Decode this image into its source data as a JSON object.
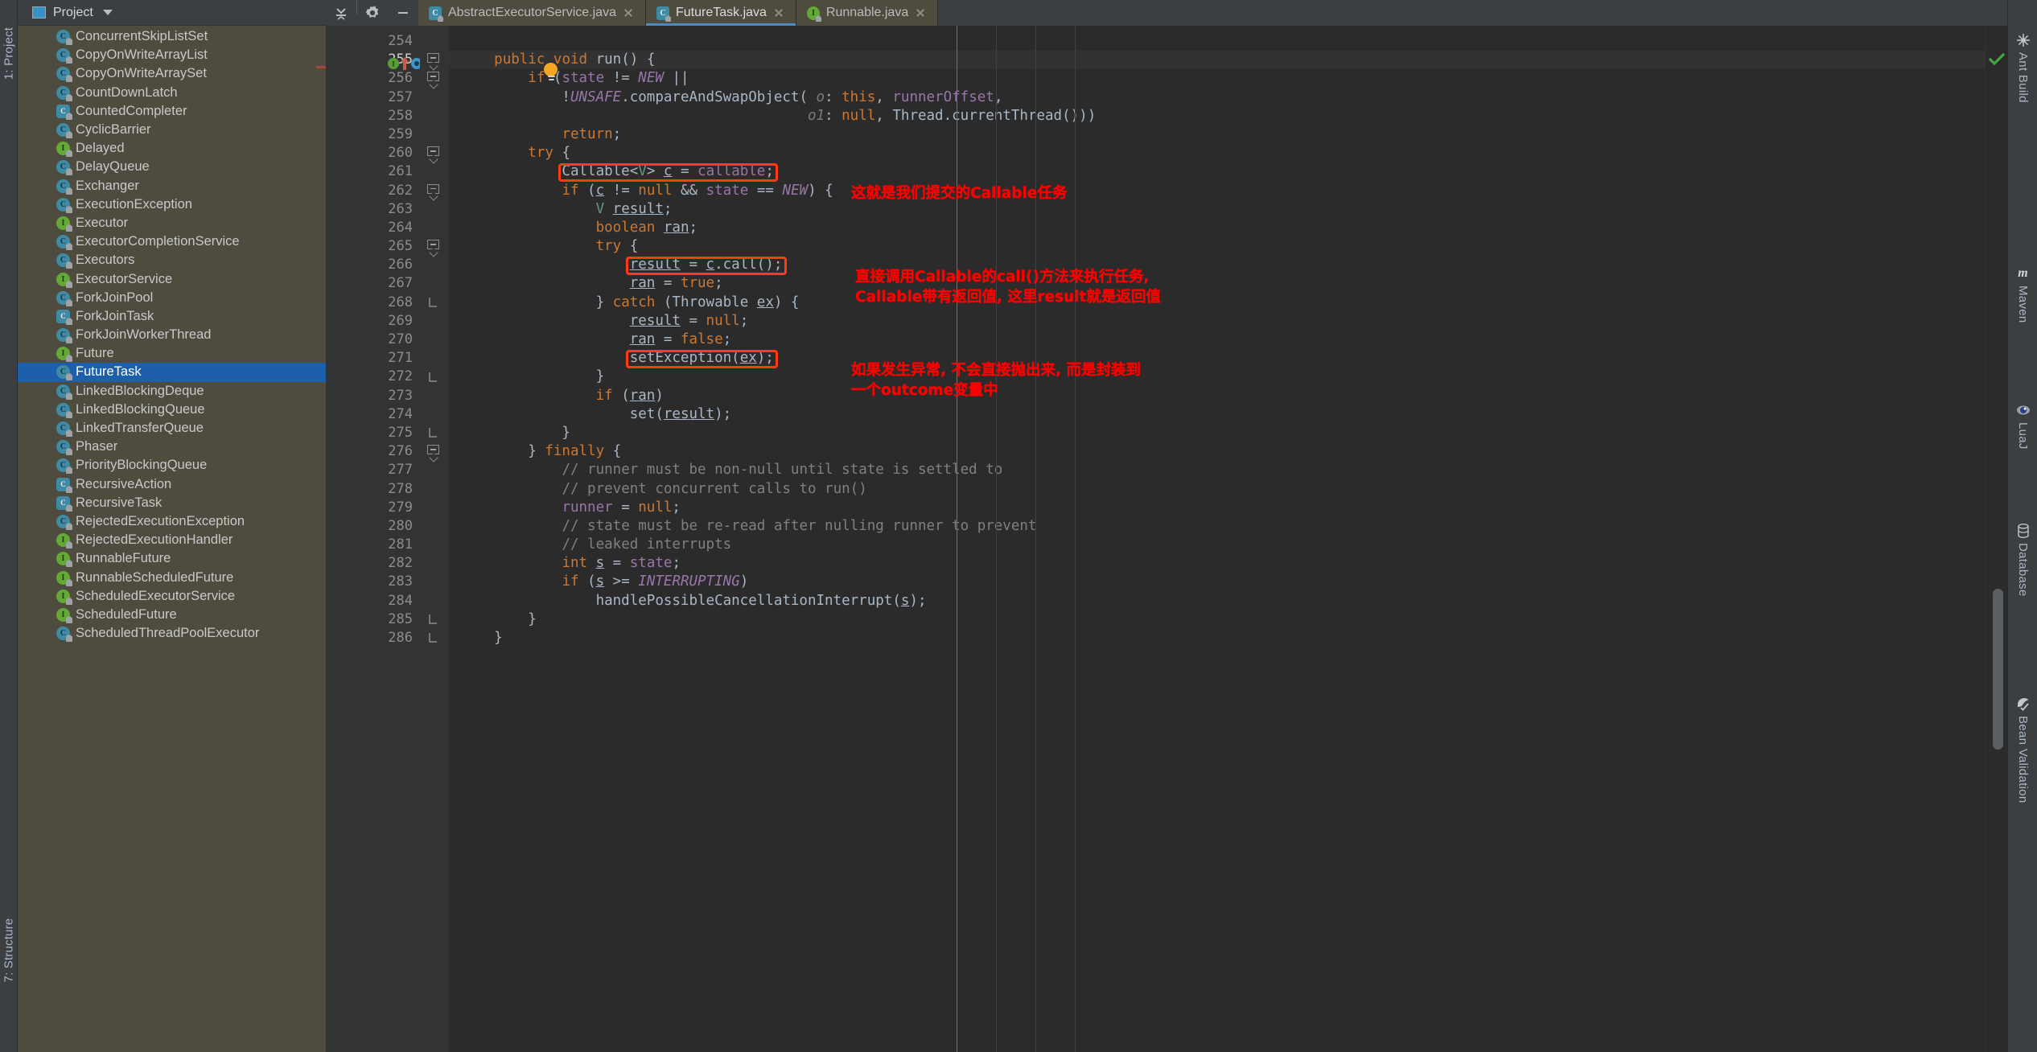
{
  "window": {
    "theme_bg": "#2b2b2b",
    "panel_bg": "#4e4b3f",
    "accent": "#4a88c7",
    "annotation_color": "#ff0000",
    "box_color": "#ff3a14"
  },
  "left_strip": {
    "top_label": "1: Project",
    "bottom_label": "7: Structure"
  },
  "project_panel": {
    "title": "Project",
    "icon": "project-window-icon",
    "caret": "chevron-down-icon",
    "tools": [
      {
        "name": "collapse-all-icon",
        "label": "Collapse All"
      },
      {
        "name": "gear-icon",
        "label": "Settings"
      },
      {
        "name": "minimize-icon",
        "label": "Hide"
      }
    ],
    "items": [
      {
        "label": "ConcurrentSkipListSet",
        "kind": "class"
      },
      {
        "label": "CopyOnWriteArrayList",
        "kind": "class"
      },
      {
        "label": "CopyOnWriteArraySet",
        "kind": "class"
      },
      {
        "label": "CountDownLatch",
        "kind": "class"
      },
      {
        "label": "CountedCompleter",
        "kind": "abstract"
      },
      {
        "label": "CyclicBarrier",
        "kind": "class"
      },
      {
        "label": "Delayed",
        "kind": "interface"
      },
      {
        "label": "DelayQueue",
        "kind": "class"
      },
      {
        "label": "Exchanger",
        "kind": "class"
      },
      {
        "label": "ExecutionException",
        "kind": "exception"
      },
      {
        "label": "Executor",
        "kind": "interface"
      },
      {
        "label": "ExecutorCompletionService",
        "kind": "class"
      },
      {
        "label": "Executors",
        "kind": "class"
      },
      {
        "label": "ExecutorService",
        "kind": "interface"
      },
      {
        "label": "ForkJoinPool",
        "kind": "class"
      },
      {
        "label": "ForkJoinTask",
        "kind": "abstract"
      },
      {
        "label": "ForkJoinWorkerThread",
        "kind": "class"
      },
      {
        "label": "Future",
        "kind": "interface"
      },
      {
        "label": "FutureTask",
        "kind": "class",
        "selected": true
      },
      {
        "label": "LinkedBlockingDeque",
        "kind": "class"
      },
      {
        "label": "LinkedBlockingQueue",
        "kind": "class"
      },
      {
        "label": "LinkedTransferQueue",
        "kind": "class"
      },
      {
        "label": "Phaser",
        "kind": "class"
      },
      {
        "label": "PriorityBlockingQueue",
        "kind": "class"
      },
      {
        "label": "RecursiveAction",
        "kind": "abstract"
      },
      {
        "label": "RecursiveTask",
        "kind": "abstract"
      },
      {
        "label": "RejectedExecutionException",
        "kind": "exception"
      },
      {
        "label": "RejectedExecutionHandler",
        "kind": "interface"
      },
      {
        "label": "RunnableFuture",
        "kind": "interface"
      },
      {
        "label": "RunnableScheduledFuture",
        "kind": "interface"
      },
      {
        "label": "ScheduledExecutorService",
        "kind": "interface"
      },
      {
        "label": "ScheduledFuture",
        "kind": "interface"
      },
      {
        "label": "ScheduledThreadPoolExecutor",
        "kind": "class"
      }
    ]
  },
  "tabs": [
    {
      "label": "AbstractExecutorService.java",
      "kind": "abstract",
      "active": false
    },
    {
      "label": "FutureTask.java",
      "kind": "class",
      "active": true
    },
    {
      "label": "Runnable.java",
      "kind": "interface",
      "active": false
    }
  ],
  "editor": {
    "first_line": 254,
    "current_line": 255,
    "gutter_icons": [
      {
        "name": "implements-method-icon",
        "letter": "I"
      },
      {
        "name": "arrow-up-icon"
      },
      {
        "name": "overrides-method-icon",
        "letter": "O"
      },
      {
        "name": "arrow-down-icon"
      }
    ],
    "intention_bulb": "lightbulb-icon",
    "inspection_status": "ok-check-icon",
    "lines": [
      {
        "n": 254,
        "text": ""
      },
      {
        "n": 255,
        "text": "    public void run() {"
      },
      {
        "n": 256,
        "text": "        if (state != NEW ||"
      },
      {
        "n": 257,
        "text": "            !UNSAFE.compareAndSwapObject( o: this, runnerOffset,"
      },
      {
        "n": 258,
        "text": "                                         o1: null, Thread.currentThread()))"
      },
      {
        "n": 259,
        "text": "            return;"
      },
      {
        "n": 260,
        "text": "        try {"
      },
      {
        "n": 261,
        "text": "            Callable<V> c = callable;"
      },
      {
        "n": 262,
        "text": "            if (c != null && state == NEW) {"
      },
      {
        "n": 263,
        "text": "                V result;"
      },
      {
        "n": 264,
        "text": "                boolean ran;"
      },
      {
        "n": 265,
        "text": "                try {"
      },
      {
        "n": 266,
        "text": "                    result = c.call();"
      },
      {
        "n": 267,
        "text": "                    ran = true;"
      },
      {
        "n": 268,
        "text": "                } catch (Throwable ex) {"
      },
      {
        "n": 269,
        "text": "                    result = null;"
      },
      {
        "n": 270,
        "text": "                    ran = false;"
      },
      {
        "n": 271,
        "text": "                    setException(ex);"
      },
      {
        "n": 272,
        "text": "                }"
      },
      {
        "n": 273,
        "text": "                if (ran)"
      },
      {
        "n": 274,
        "text": "                    set(result);"
      },
      {
        "n": 275,
        "text": "            }"
      },
      {
        "n": 276,
        "text": "        } finally {"
      },
      {
        "n": 277,
        "text": "            // runner must be non-null until state is settled to"
      },
      {
        "n": 278,
        "text": "            // prevent concurrent calls to run()"
      },
      {
        "n": 279,
        "text": "            runner = null;"
      },
      {
        "n": 280,
        "text": "            // state must be re-read after nulling runner to prevent"
      },
      {
        "n": 281,
        "text": "            // leaked interrupts"
      },
      {
        "n": 282,
        "text": "            int s = state;"
      },
      {
        "n": 283,
        "text": "            if (s >= INTERRUPTING)"
      },
      {
        "n": 284,
        "text": "                handlePossibleCancellationInterrupt(s);"
      },
      {
        "n": 285,
        "text": "        }"
      },
      {
        "n": 286,
        "text": "    }"
      }
    ]
  },
  "annotations": [
    {
      "name": "callable-task-note",
      "text": "这就是我们提交的Callable任务",
      "target_line": 261
    },
    {
      "name": "call-method-note",
      "text": "直接调用Callable的call()方法来执行任务,\nCallable带有返回值, 这里result就是返回值",
      "target_line": 266
    },
    {
      "name": "set-exception-note",
      "text": "如果发生异常, 不会直接抛出来, 而是封装到\n一个outcome变量中",
      "target_line": 271
    }
  ],
  "right_strip": [
    {
      "label": "Ant Build",
      "icon": "ant-icon"
    },
    {
      "label": "Maven",
      "icon": "maven-icon"
    },
    {
      "label": "LuaJ",
      "icon": "luaj-icon"
    },
    {
      "label": "Database",
      "icon": "database-icon"
    },
    {
      "label": "Bean Validation",
      "icon": "bean-validation-icon"
    }
  ]
}
